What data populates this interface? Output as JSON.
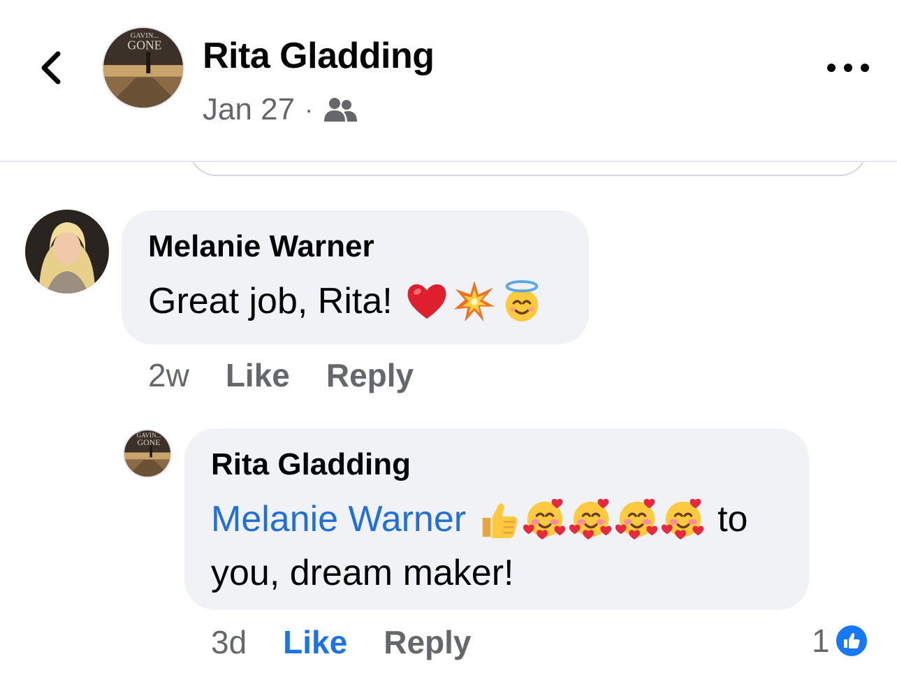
{
  "header": {
    "name": "Rita Gladding",
    "date": "Jan 27",
    "separator": "·",
    "audience_icon": "friends-icon",
    "avatar_text_top": "GAVIN...",
    "avatar_text_main": "GONE"
  },
  "comments": [
    {
      "author": "Melanie Warner",
      "text": "Great job, Rita!",
      "emojis": [
        "red-heart",
        "collision",
        "smiling-face-with-halo"
      ],
      "time": "2w",
      "like_label": "Like",
      "reply_label": "Reply"
    }
  ],
  "reply": {
    "author": "Rita Gladding",
    "mention": "Melanie Warner",
    "emojis": [
      "thumbs-up",
      "smiling-face-with-hearts",
      "smiling-face-with-hearts",
      "smiling-face-with-hearts",
      "smiling-face-with-hearts"
    ],
    "text_after": "to",
    "text_line2": "you, dream maker!",
    "time": "3d",
    "like_label": "Like",
    "reply_label": "Reply",
    "reaction_count": "1",
    "reaction_icon": "like-icon"
  },
  "colors": {
    "bubble": "#f0f2f5",
    "mention": "#216fdb",
    "liked": "#1b74e4",
    "meta": "#65676b"
  }
}
